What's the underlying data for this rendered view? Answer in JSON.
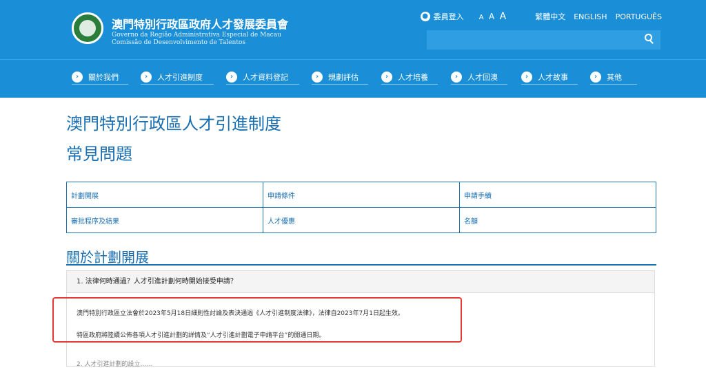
{
  "header": {
    "title_zh": "澳門特別行政區政府人才發展委員會",
    "title_pt_line1": "Governo da Região Administrativa Especial de Macau",
    "title_pt_line2": "Comissão de Desenvolvimento de Talentos",
    "member_login": "委員登入",
    "font_sizes": [
      "A",
      "A",
      "A"
    ],
    "languages": [
      "繁體中文",
      "ENGLISH",
      "PORTUGUÊS"
    ],
    "search_placeholder": ""
  },
  "nav": {
    "items": [
      "關於我們",
      "人才引進制度",
      "人才資料登記",
      "規劃評估",
      "人才培養",
      "人才回澳",
      "人才故事",
      "其他"
    ]
  },
  "page": {
    "title_line1": "澳門特別行政區人才引進制度",
    "title_line2": "常見問題"
  },
  "categories": [
    [
      "計劃開展",
      "申請條件",
      "申請手續"
    ],
    [
      "審批程序及結果",
      "人才優惠",
      "名額"
    ]
  ],
  "section": {
    "title": "關於計劃開展",
    "faq_question": "1. 法律何時通過？人才引進計劃何時開始接受申請？",
    "faq_answer_1": "澳門特別行政區立法會於2023年5月18日細則性討論及表決通過《人才引進制度法律》，法律自2023年7月1日起生效。",
    "faq_answer_2": "特區政府將陸續公佈各項人才引進計劃的詳情及“人才引進計劃電子申請平台”的開通日期。",
    "next_question": "2. 人才引進計劃的設立……"
  },
  "colors": {
    "brand_blue": "#1a8fd8",
    "heading_blue": "#1a6fb0",
    "highlight_red": "#e53935"
  }
}
